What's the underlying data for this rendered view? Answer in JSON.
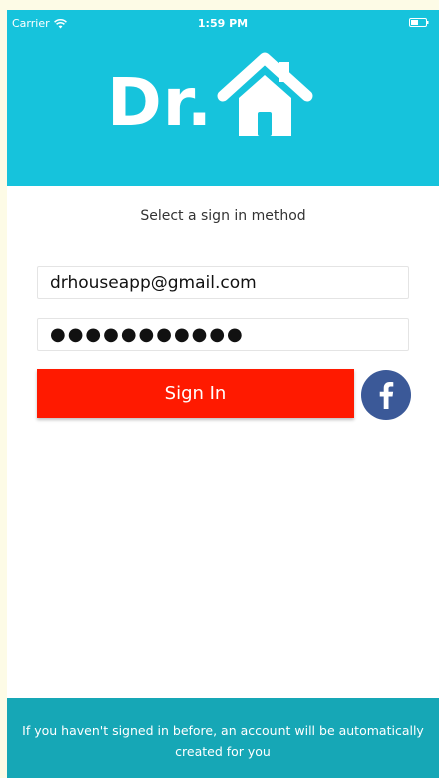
{
  "status_bar": {
    "carrier": "Carrier",
    "time": "1:59 PM",
    "icons": [
      "wifi-icon",
      "battery-icon"
    ]
  },
  "header": {
    "logo_text": "Dr.",
    "logo_icon": "house-icon"
  },
  "login": {
    "subtitle": "Select a sign in method",
    "email_value": "drhouseapp@gmail.com",
    "password_value": "●●●●●●●●●●●",
    "sign_in_label": "Sign In",
    "facebook_icon": "facebook-icon"
  },
  "footer": {
    "text": "If you haven't signed in before, an account will be automatically created for you"
  },
  "colors": {
    "header_bg": "#16c3dc",
    "sign_in_bg": "#ff1a00",
    "facebook_bg": "#3b5998",
    "footer_bg": "#16a7b6",
    "page_bg": "#fdfbe6"
  }
}
